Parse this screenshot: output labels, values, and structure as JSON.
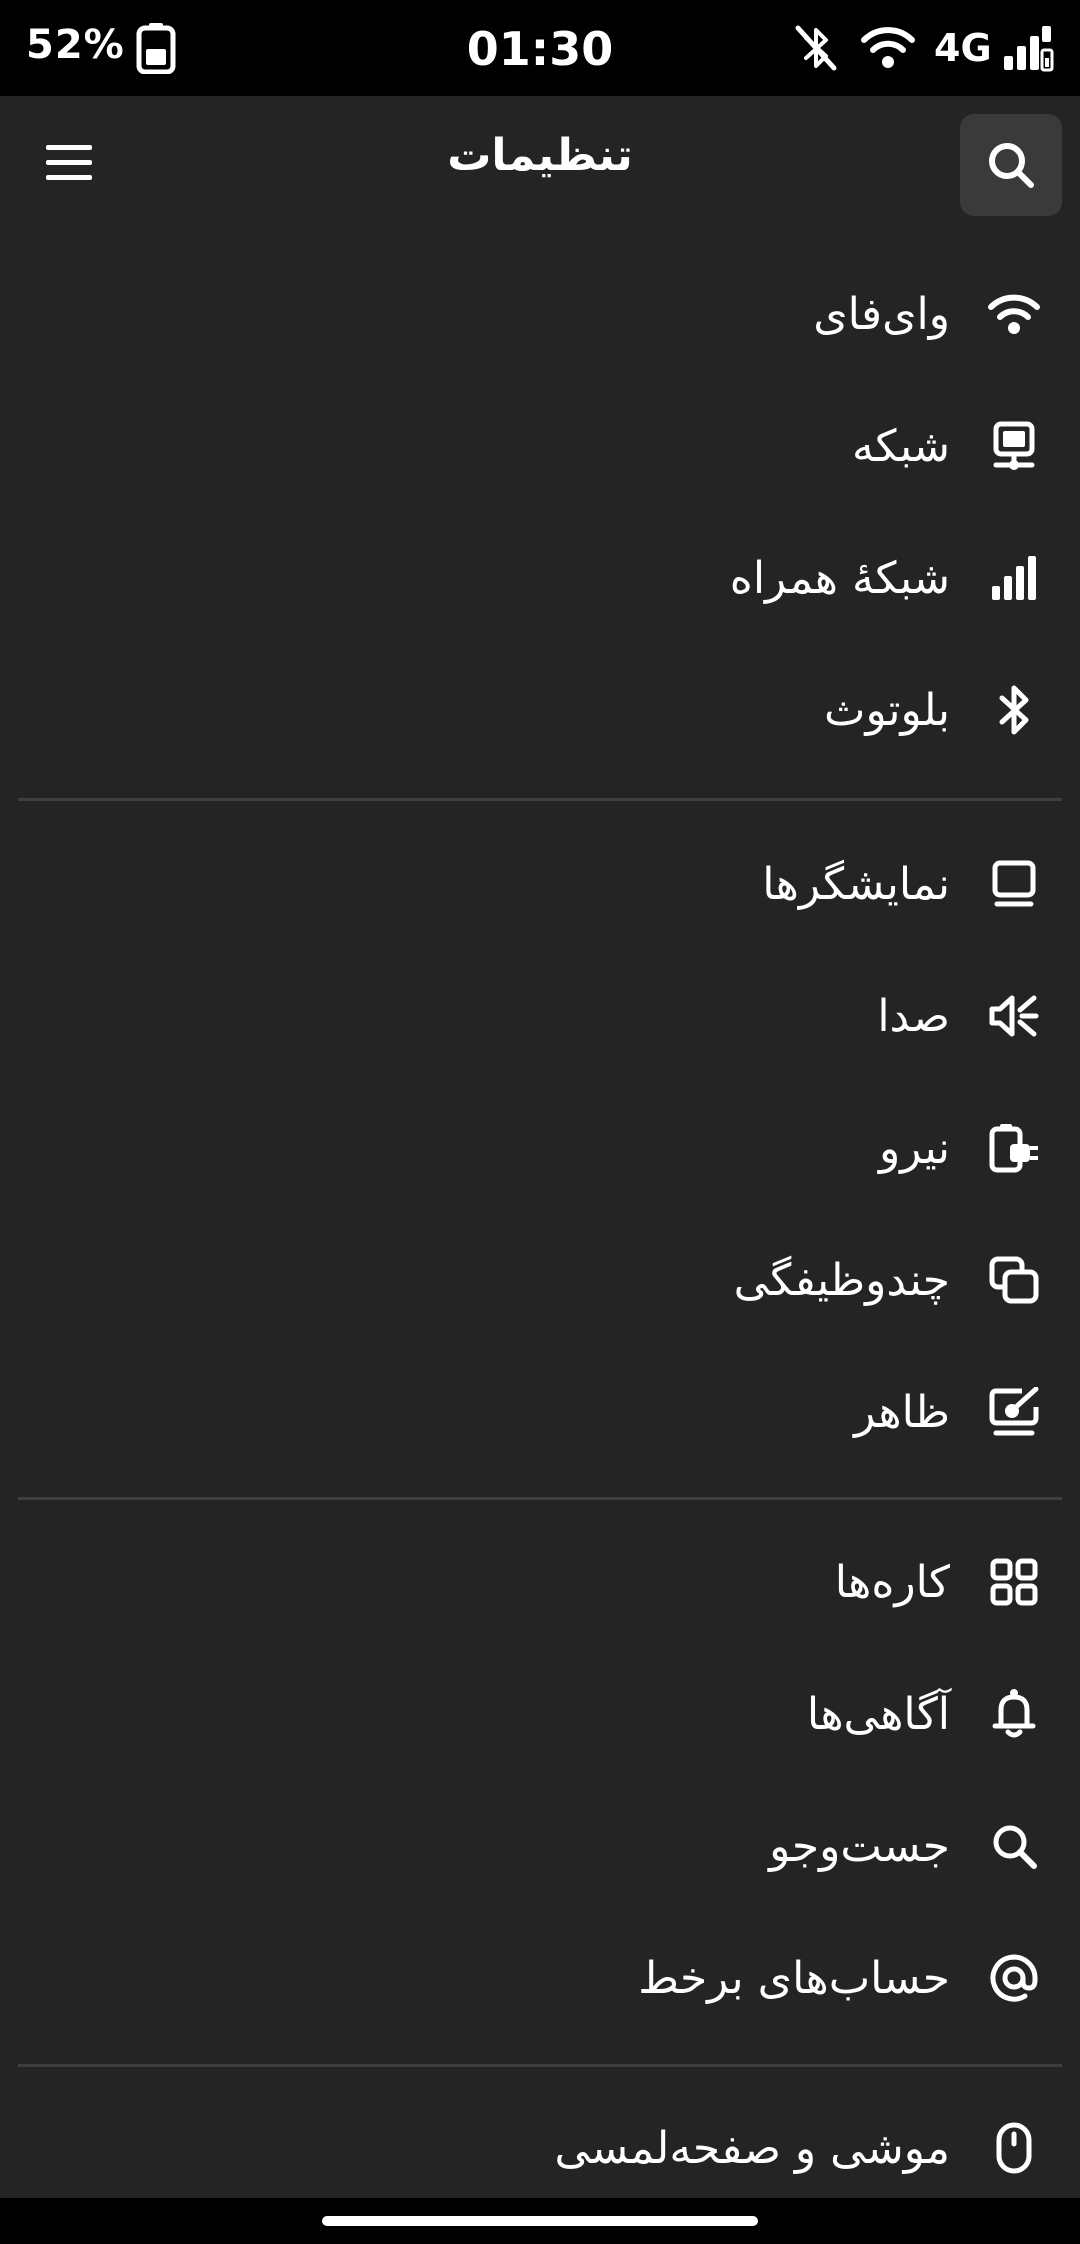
{
  "status_bar": {
    "battery_percent": "52%",
    "time": "01:30",
    "network_type": "4G",
    "icons": [
      "battery-icon",
      "bluetooth-off-icon",
      "wifi-icon",
      "signal-icon"
    ]
  },
  "header": {
    "title": "تنظیمات",
    "menu_icon": "hamburger-menu-icon",
    "search_icon": "search-icon"
  },
  "settings": {
    "wifi": "وای‌فای",
    "network": "شبکه",
    "mobile_network": "شبکهٔ همراه",
    "bluetooth": "بلوتوث",
    "displays": "نمایشگرها",
    "sound": "صدا",
    "power": "نیرو",
    "multitasking": "چندوظیفگی",
    "appearance": "ظاهر",
    "apps": "کاره‌ها",
    "notifications": "آگاهی‌ها",
    "search": "جست‌وجو",
    "online_accounts": "حساب‌های برخط",
    "mouse_touchpad": "موشی و صفحه‌لمسی"
  },
  "colors": {
    "background": "#242424",
    "status_bar": "#000000",
    "search_button": "#3a3a3a",
    "divider": "#3e3e3e",
    "text": "#ffffff"
  }
}
